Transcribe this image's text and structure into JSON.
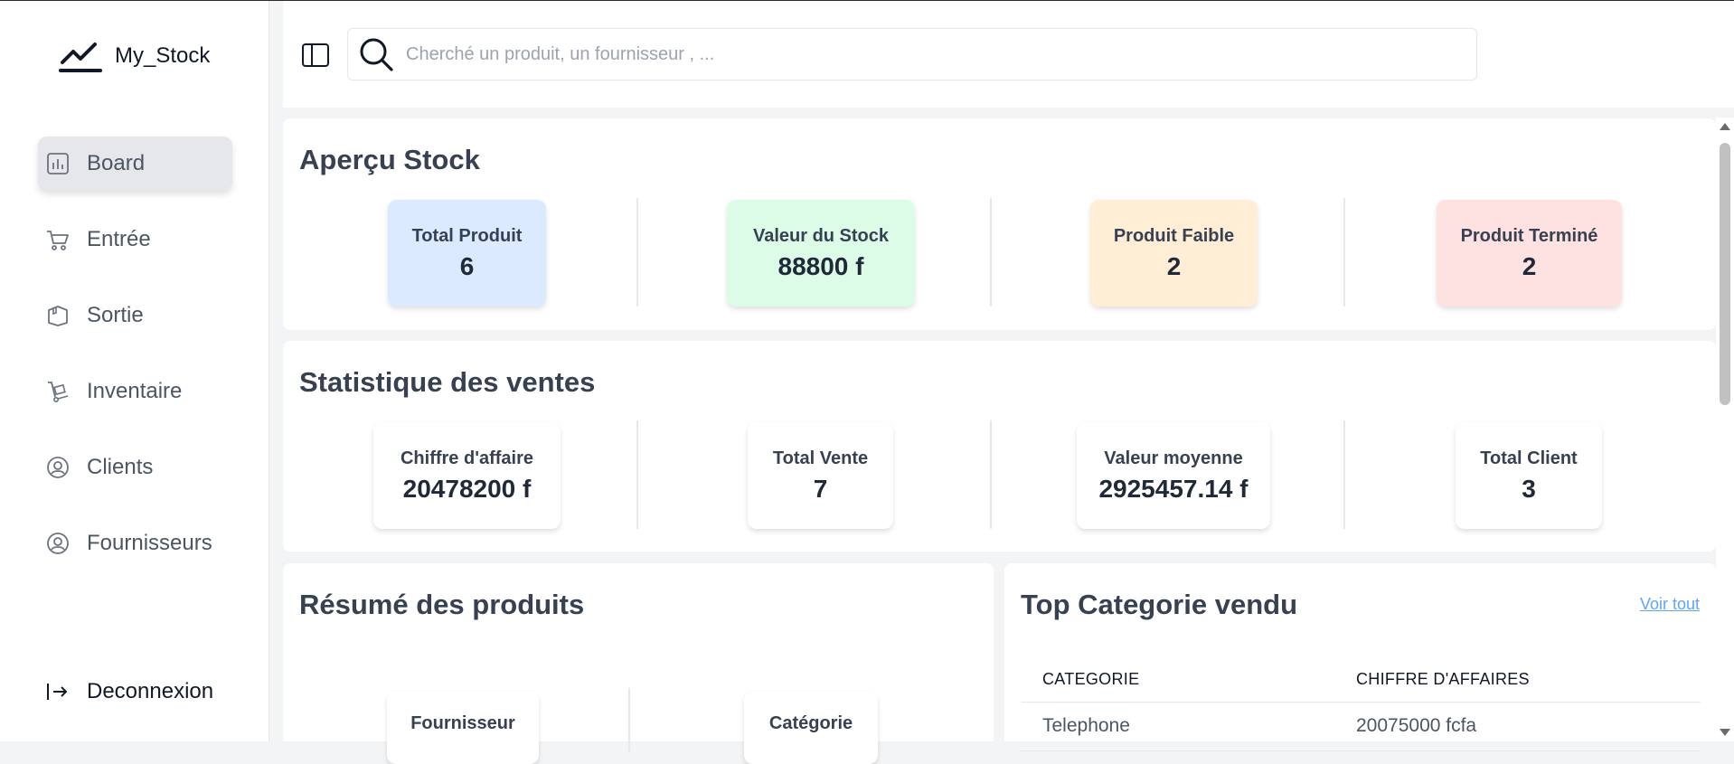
{
  "app": {
    "name": "My_Stock"
  },
  "sidebar": {
    "items": [
      {
        "label": "Board",
        "icon": "chart-bar-icon"
      },
      {
        "label": "Entrée",
        "icon": "cart-icon"
      },
      {
        "label": "Sortie",
        "icon": "box-icon"
      },
      {
        "label": "Inventaire",
        "icon": "dolly-icon"
      },
      {
        "label": "Clients",
        "icon": "user-circle-icon"
      },
      {
        "label": "Fournisseurs",
        "icon": "user-circle-icon"
      }
    ],
    "active": "Board",
    "logout_label": "Deconnexion"
  },
  "header": {
    "search_placeholder": "Cherché un produit, un fournisseur , ..."
  },
  "stock_overview": {
    "title": "Aperçu Stock",
    "cards": [
      {
        "label": "Total Produit",
        "value": "6",
        "color": "#dbeafe"
      },
      {
        "label": "Valeur du Stock",
        "value": "88800 f",
        "color": "#dcfce7"
      },
      {
        "label": "Produit Faible",
        "value": "2",
        "color": "#ffedd5"
      },
      {
        "label": "Produit Terminé",
        "value": "2",
        "color": "#fee2e2"
      }
    ]
  },
  "sales_stats": {
    "title": "Statistique des ventes",
    "cards": [
      {
        "label": "Chiffre d'affaire",
        "value": "20478200 f"
      },
      {
        "label": "Total Vente",
        "value": "7"
      },
      {
        "label": "Valeur moyenne",
        "value": "2925457.14 f"
      },
      {
        "label": "Total Client",
        "value": "3"
      }
    ]
  },
  "products_summary": {
    "title": "Résumé des produits",
    "cards": [
      {
        "label": "Fournisseur"
      },
      {
        "label": "Catégorie"
      }
    ]
  },
  "top_categories": {
    "title": "Top Categorie vendu",
    "link_label": "Voir tout",
    "columns": [
      "CATEGORIE",
      "CHIFFRE D'AFFAIRES"
    ],
    "rows": [
      [
        "Telephone",
        "20075000 fcfa"
      ]
    ]
  },
  "colors": {
    "accent_link": "#60a5fa",
    "active_nav_bg": "#e5e7eb"
  }
}
